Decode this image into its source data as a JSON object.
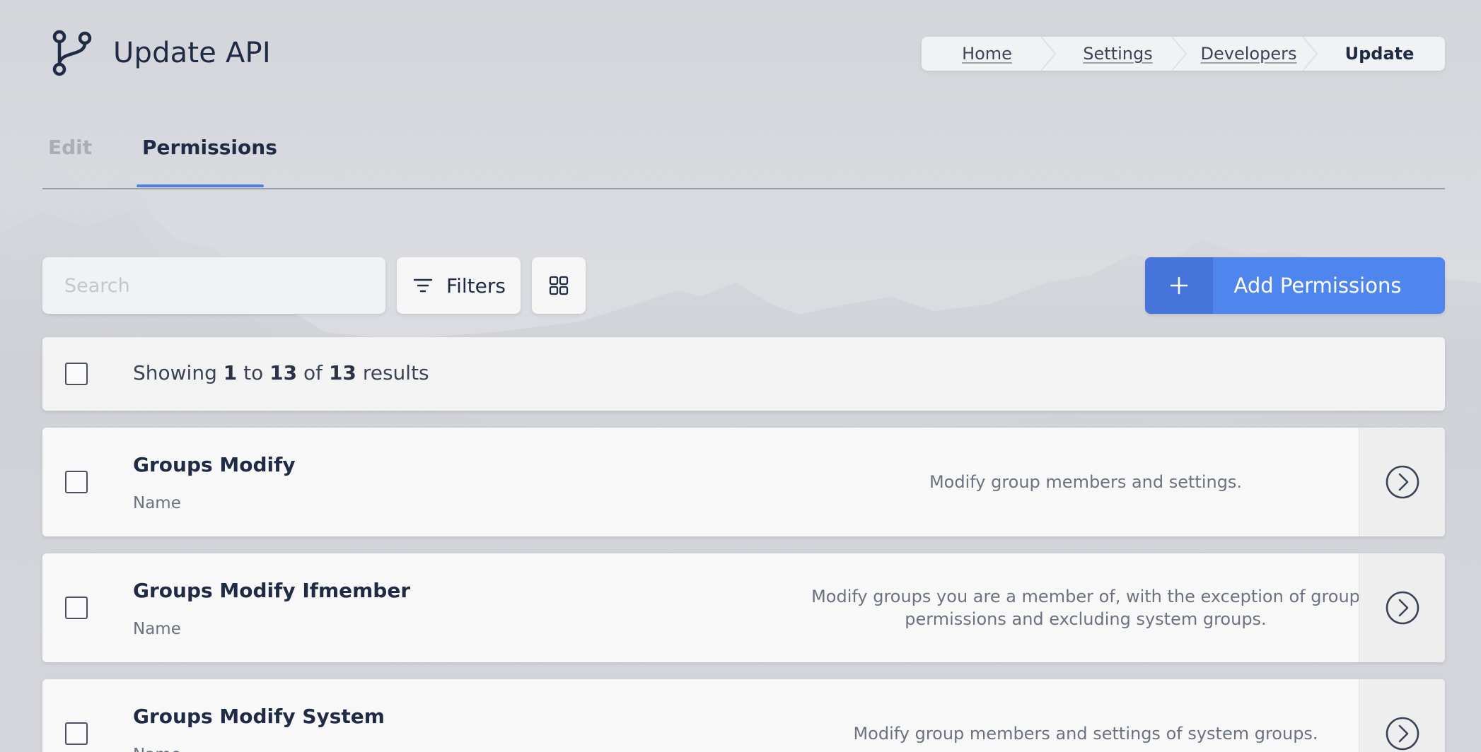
{
  "header": {
    "title": "Update API",
    "icon": "git-branch-icon"
  },
  "breadcrumb": [
    {
      "label": "Home"
    },
    {
      "label": "Settings"
    },
    {
      "label": "Developers"
    },
    {
      "label": "Update"
    }
  ],
  "tabs": {
    "items": [
      {
        "label": "Edit"
      },
      {
        "label": "Permissions"
      }
    ],
    "active": "Permissions"
  },
  "toolbar": {
    "search_placeholder": "Search",
    "filters_label": "Filters",
    "add_label": "Add Permissions"
  },
  "results": {
    "prefix": "Showing",
    "from": "1",
    "to_word": "to",
    "to": "13",
    "of_word": "of",
    "total": "13",
    "suffix": "results"
  },
  "rows": [
    {
      "name": "Groups Modify",
      "sub": "Name",
      "description": "Modify group members and settings."
    },
    {
      "name": "Groups Modify Ifmember",
      "sub": "Name",
      "description": "Modify groups you are a member of, with the exception of group permissions and excluding system groups."
    },
    {
      "name": "Groups Modify System",
      "sub": "Name",
      "description": "Modify group members and settings of system groups."
    }
  ],
  "colors": {
    "accent": "#4f86ee",
    "accent_dark": "#4674da",
    "text_primary": "#1f2a44",
    "text_muted": "#6b7280"
  }
}
